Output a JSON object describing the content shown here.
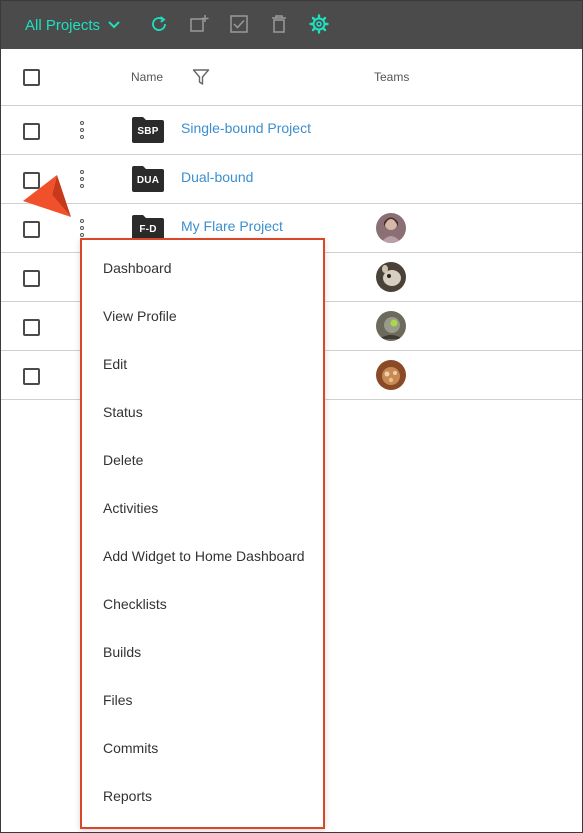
{
  "toolbar": {
    "title": "All Projects",
    "accent": "#1ee0c0",
    "background": "#4b4b4b",
    "icons": [
      "refresh-icon",
      "add-project-icon",
      "checklist-icon",
      "trash-icon",
      "gear-icon"
    ]
  },
  "table": {
    "headers": {
      "name": "Name",
      "teams": "Teams"
    },
    "rows": [
      {
        "badge": "SBP",
        "name": "Single-bound Project",
        "has_avatar": false
      },
      {
        "badge": "DUA",
        "name": "Dual-bound",
        "has_avatar": false
      },
      {
        "badge": "F-D",
        "name": "My Flare Project",
        "has_avatar": true
      },
      {
        "badge": "",
        "name": "",
        "has_avatar": true
      },
      {
        "badge": "",
        "name": "",
        "has_avatar": true
      },
      {
        "badge": "",
        "name": "",
        "has_avatar": true
      }
    ],
    "link_color": "#3b8fd0"
  },
  "context_menu": {
    "border_color": "#d9472b",
    "items": [
      "Dashboard",
      "View Profile",
      "Edit",
      "Status",
      "Delete",
      "Activities",
      "Add Widget to Home Dashboard",
      "Checklists",
      "Builds",
      "Files",
      "Commits",
      "Reports"
    ]
  },
  "annotation": {
    "pointer_color": "#f0502a"
  }
}
